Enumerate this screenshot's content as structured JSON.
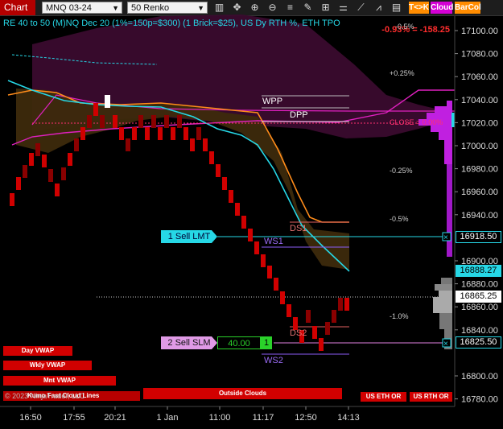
{
  "toolbar": {
    "title": "Chart",
    "instrument": "MNQ 03-24",
    "bar_type": "50 Renko",
    "buttons": {
      "tk": "T<>K",
      "cloud": "Cloud",
      "barcol": "BarCol"
    },
    "icons": [
      "bar-style-icon",
      "crosshair-icon",
      "zoom-in-icon",
      "zoom-out-icon",
      "properties-icon",
      "draw-icon",
      "text-icon",
      "indicator-icon",
      "strategy-icon",
      "chart-trader-icon",
      "data-box-icon"
    ]
  },
  "chart": {
    "banner": "RE 40 to 50 (M)NQ Dec 20 (1%=150p=$300) (1 Brick=$25), US Dy RTH %, ETH TPO",
    "pct_top": "-0.93% = -158.25",
    "pct_labels": [
      "-0.5%",
      "+0.25%",
      "CLOSE = 0.00%",
      "-0.25%",
      "-0.5%",
      "-1.0%"
    ],
    "levels": {
      "wpp": "WPP",
      "dpp": "DPP",
      "ds1": "DS1",
      "ws1": "WS1",
      "ds2": "DS2",
      "ws2": "WS2"
    },
    "orders": {
      "sell_lmt": {
        "label": "1 Sell LMT"
      },
      "sell_slm": {
        "label": "2 Sell SLM",
        "qty": "40.00",
        "count": "1"
      }
    },
    "price_axis": [
      "17100.00",
      "17080.00",
      "17060.00",
      "17040.00",
      "17020.00",
      "17000.00",
      "16980.00",
      "16960.00",
      "16940.00",
      "16900.00",
      "16880.00",
      "16860.00",
      "16840.00",
      "16800.00",
      "16780.00"
    ],
    "price_markers": {
      "sell_lmt": "16918.50",
      "cyan_line": "16888.27",
      "last": "16865.25",
      "sell_slm": "16825.50"
    },
    "time_axis": [
      "16:50",
      "17:55",
      "20:21",
      "1 Jan",
      "11:00",
      "11:17",
      "12:50",
      "14:13"
    ],
    "tiles": {
      "day_vwap": "Day VWAP",
      "wkly_vwap": "Wkly VWAP",
      "mnt_vwap": "Mnt VWAP",
      "outside_clouds": "Outside Clouds",
      "us_eth_or": "US ETH OR",
      "us_rth_or": "US RTH OR"
    },
    "copyright": "© 2023 NinjaTrader, LLC",
    "overlay_text": "Kumo Fast Cloud Lines"
  }
}
